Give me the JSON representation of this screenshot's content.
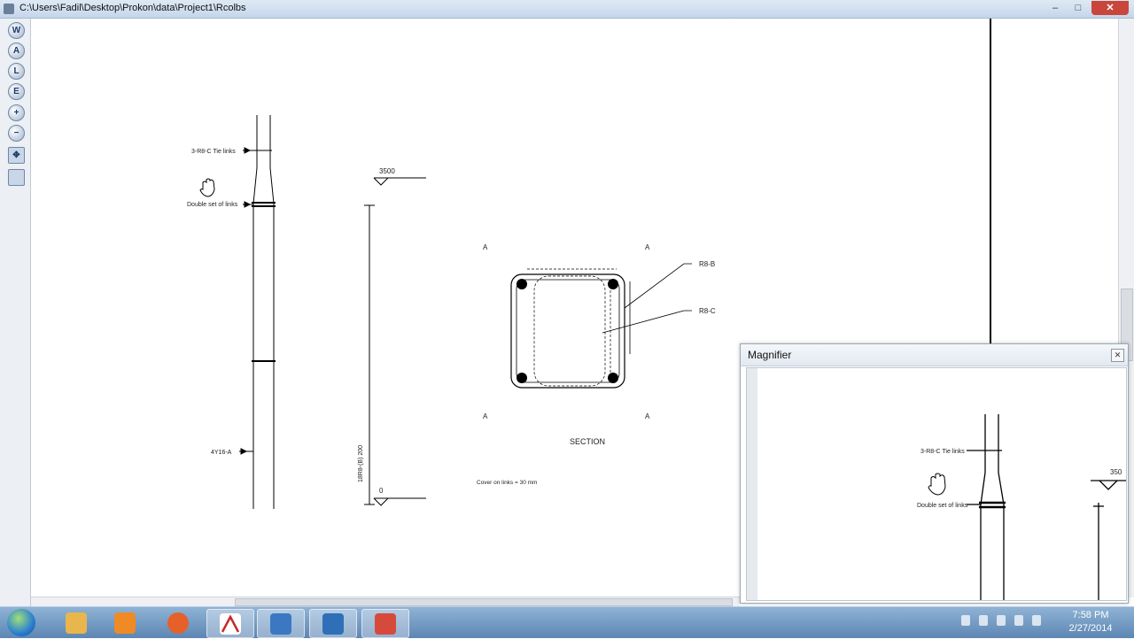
{
  "window": {
    "title": "C:\\Users\\Fadil\\Desktop\\Prokon\\data\\Project1\\Rcolbs",
    "minimize": "–",
    "maximize": "□",
    "close": "✕"
  },
  "toolbar": {
    "tools": [
      {
        "label": "W",
        "icon": "w-icon"
      },
      {
        "label": "A",
        "icon": "a-icon"
      },
      {
        "label": "L",
        "icon": "l-icon"
      },
      {
        "label": "E",
        "icon": "e-icon"
      },
      {
        "label": "+",
        "icon": "zoom-in-icon"
      },
      {
        "label": "−",
        "icon": "zoom-out-icon"
      },
      {
        "label": "✥",
        "icon": "pan-icon"
      },
      {
        "label": "",
        "icon": "print-icon"
      }
    ]
  },
  "drawing": {
    "elevation": {
      "label_tie_links": "3-R8-C Tie links",
      "label_double_links": "Double set of links",
      "label_main_bars": "4Y16-A"
    },
    "levels": {
      "top": "3500",
      "bottom": "0",
      "spacing": "18R8-(B) 200"
    },
    "section": {
      "marker_a": "A",
      "label_b": "R8-B",
      "label_c": "R8-C",
      "title": "SECTION",
      "cover_note": "Cover on links = 30 mm"
    }
  },
  "magnifier": {
    "title": "Magnifier",
    "close": "✕",
    "zoom_tie_links": "3-R8-C Tie links",
    "zoom_double_links": "Double set of links",
    "zoom_level_partial": "350"
  },
  "taskbar": {
    "apps": [
      {
        "name": "file-explorer",
        "color": "#e8b64c"
      },
      {
        "name": "media-player",
        "color": "#f08a24"
      },
      {
        "name": "firefox",
        "color": "#e6602a"
      },
      {
        "name": "prokon",
        "color": "#ffffff"
      },
      {
        "name": "outlook",
        "color": "#3b78c2"
      },
      {
        "name": "network-app",
        "color": "#2f6fb8"
      },
      {
        "name": "dice-app",
        "color": "#d64a3b"
      }
    ],
    "time": "7:58 PM",
    "date": "2/27/2014"
  }
}
